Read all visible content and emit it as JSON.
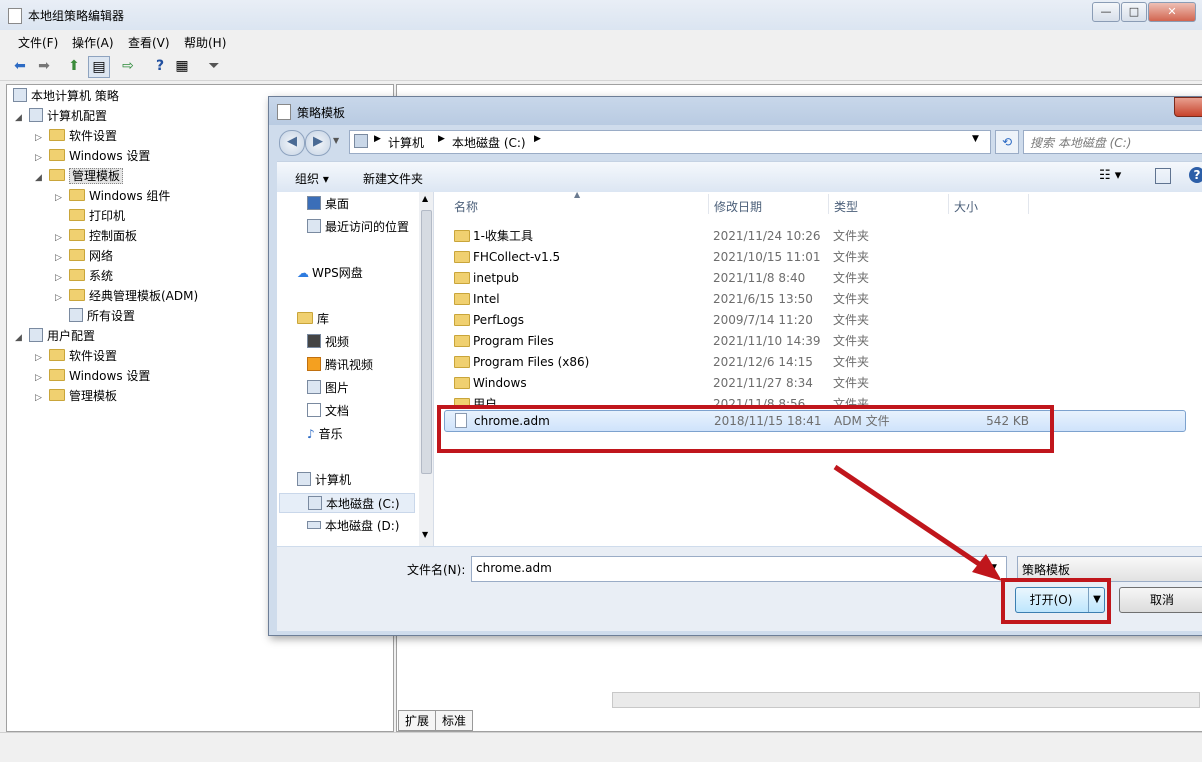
{
  "window": {
    "title": "本地组策略编辑器",
    "buttons": {
      "minimize": "—",
      "maximize": "□",
      "close": "✕"
    }
  },
  "menu": [
    "文件(F)",
    "操作(A)",
    "查看(V)",
    "帮助(H)"
  ],
  "tree": [
    {
      "label": "本地计算机 策略",
      "level": 0,
      "icon": "policy-icon"
    },
    {
      "label": "计算机配置",
      "level": 1,
      "icon": "computer-icon",
      "expanded": true
    },
    {
      "label": "软件设置",
      "level": 2,
      "icon": "folder-icon"
    },
    {
      "label": "Windows 设置",
      "level": 2,
      "icon": "folder-icon"
    },
    {
      "label": "管理模板",
      "level": 2,
      "icon": "folder-icon",
      "expanded": true,
      "selected": true
    },
    {
      "label": "Windows 组件",
      "level": 3,
      "icon": "folder-icon"
    },
    {
      "label": "打印机",
      "level": 3,
      "icon": "folder-icon"
    },
    {
      "label": "控制面板",
      "level": 3,
      "icon": "folder-icon"
    },
    {
      "label": "网络",
      "level": 3,
      "icon": "folder-icon"
    },
    {
      "label": "系统",
      "level": 3,
      "icon": "folder-icon"
    },
    {
      "label": "经典管理模板(ADM)",
      "level": 3,
      "icon": "folder-icon"
    },
    {
      "label": "所有设置",
      "level": 3,
      "icon": "settings-icon"
    },
    {
      "label": "用户配置",
      "level": 1,
      "icon": "user-icon",
      "expanded": true
    },
    {
      "label": "软件设置",
      "level": 2,
      "icon": "folder-icon"
    },
    {
      "label": "Windows 设置",
      "level": 2,
      "icon": "folder-icon"
    },
    {
      "label": "管理模板",
      "level": 2,
      "icon": "folder-icon"
    }
  ],
  "bottom_tabs": [
    "扩展",
    "标准"
  ],
  "dialog": {
    "title": "策略模板",
    "breadcrumb": [
      "计算机",
      "本地磁盘 (C:)"
    ],
    "search_placeholder": "搜索 本地磁盘 (C:)",
    "organize": "组织 ▾",
    "new_folder": "新建文件夹",
    "nav": {
      "desktop": "桌面",
      "recent": "最近访问的位置",
      "wps": "WPS网盘",
      "library": "库",
      "video": "视频",
      "tencent_video": "腾讯视频",
      "pictures": "图片",
      "documents": "文档",
      "music": "音乐",
      "computer": "计算机",
      "drive_c": "本地磁盘 (C:)",
      "drive_d": "本地磁盘 (D:)"
    },
    "columns": {
      "name": "名称",
      "date": "修改日期",
      "type": "类型",
      "size": "大小"
    },
    "files": [
      {
        "name": "1-收集工具",
        "date": "2021/11/24 10:26",
        "type": "文件夹",
        "size": ""
      },
      {
        "name": "FHCollect-v1.5",
        "date": "2021/10/15 11:01",
        "type": "文件夹",
        "size": ""
      },
      {
        "name": "inetpub",
        "date": "2021/11/8 8:40",
        "type": "文件夹",
        "size": ""
      },
      {
        "name": "Intel",
        "date": "2021/6/15 13:50",
        "type": "文件夹",
        "size": ""
      },
      {
        "name": "PerfLogs",
        "date": "2009/7/14 11:20",
        "type": "文件夹",
        "size": ""
      },
      {
        "name": "Program Files",
        "date": "2021/11/10 14:39",
        "type": "文件夹",
        "size": ""
      },
      {
        "name": "Program Files (x86)",
        "date": "2021/12/6 14:15",
        "type": "文件夹",
        "size": ""
      },
      {
        "name": "Windows",
        "date": "2021/11/27 8:34",
        "type": "文件夹",
        "size": ""
      },
      {
        "name": "用户",
        "date": "2021/11/8 8:56",
        "type": "文件夹",
        "size": ""
      },
      {
        "name": "chrome.adm",
        "date": "2018/11/15 18:41",
        "type": "ADM 文件",
        "size": "542 KB",
        "selected": true
      }
    ],
    "filename_label": "文件名(N):",
    "filename_value": "chrome.adm",
    "filetype": "策略模板",
    "open_button": "打开(O)",
    "cancel_button": "取消"
  },
  "colors": {
    "highlight": "#c0161c",
    "selection": "#cfe3fb"
  }
}
